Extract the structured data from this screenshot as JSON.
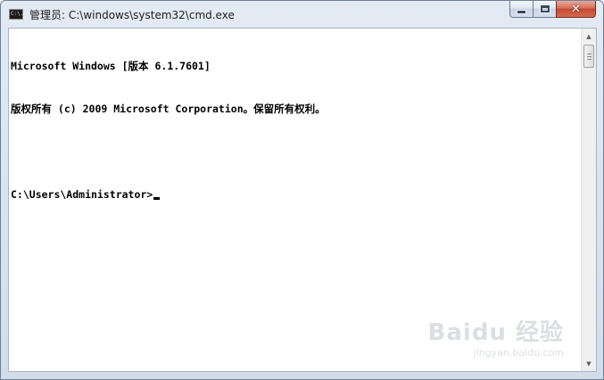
{
  "window": {
    "title": "管理员: C:\\windows\\system32\\cmd.exe",
    "icon": "cmd-icon",
    "icon_text": "C:\\."
  },
  "console": {
    "lines": [
      "Microsoft Windows [版本 6.1.7601]",
      "版权所有 (c) 2009 Microsoft Corporation。保留所有权利。",
      "",
      "C:\\Users\\Administrator>"
    ]
  },
  "scrollbar": {
    "up_arrow": "▲",
    "down_arrow": "▼"
  },
  "watermark": {
    "logo": "Baidu 经验",
    "url": "jingyan.baidu.com"
  }
}
